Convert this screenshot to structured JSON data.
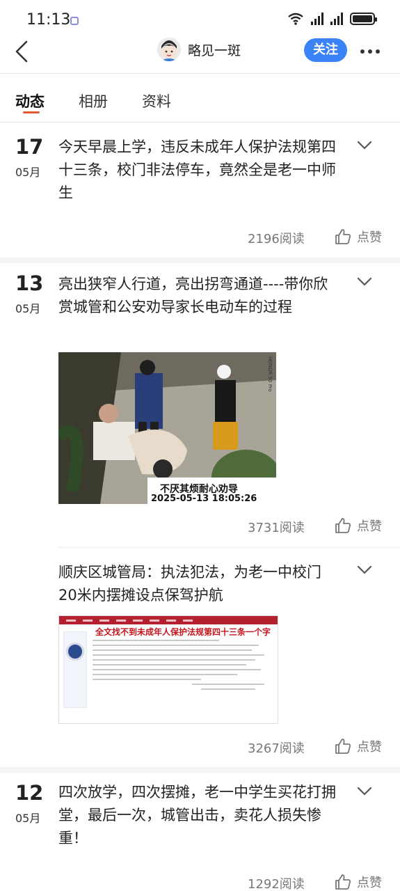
{
  "status_bar": {
    "time": "11:13"
  },
  "nav": {
    "username": "略见一斑",
    "follow_label": "关注"
  },
  "tabs": [
    {
      "label": "动态"
    },
    {
      "label": "相册"
    },
    {
      "label": "资料"
    }
  ],
  "posts": [
    {
      "day": "17",
      "month": "05月",
      "text": "今天早晨上学，违反未成年人保护法规第四十三条，校门非法停车，竟然全是老一中师生",
      "reads": "2196阅读",
      "like_label": "点赞"
    },
    {
      "day": "13",
      "month": "05月",
      "text": "亮出狭窄人行道，亮出拐弯通道----带你欣赏城管和公安劝导家长电动车的过程",
      "image_caption": "不厌其烦耐心劝导",
      "image_timestamp": "2025-05-13  18:05:26",
      "image_watermark": "HONOR 50 Pro",
      "reads": "3731阅读",
      "like_label": "点赞"
    },
    {
      "text": "顺庆区城管局：执法犯法，为老一中校门20米内摆摊设点保驾护航",
      "image_title": "全文找不到未成年人保护法规第四十三条一个字",
      "reads": "3267阅读",
      "like_label": "点赞"
    },
    {
      "day": "12",
      "month": "05月",
      "text": "四次放学，四次摆摊，老一中学生买花打拥堂，最后一次，城管出击，卖花人损失惨重！",
      "reads": "1292阅读",
      "like_label": "点赞"
    }
  ],
  "colors": {
    "accent": "#3b82f6",
    "tab_indicator": "#e05a2b",
    "doc_red": "#c4141e"
  }
}
